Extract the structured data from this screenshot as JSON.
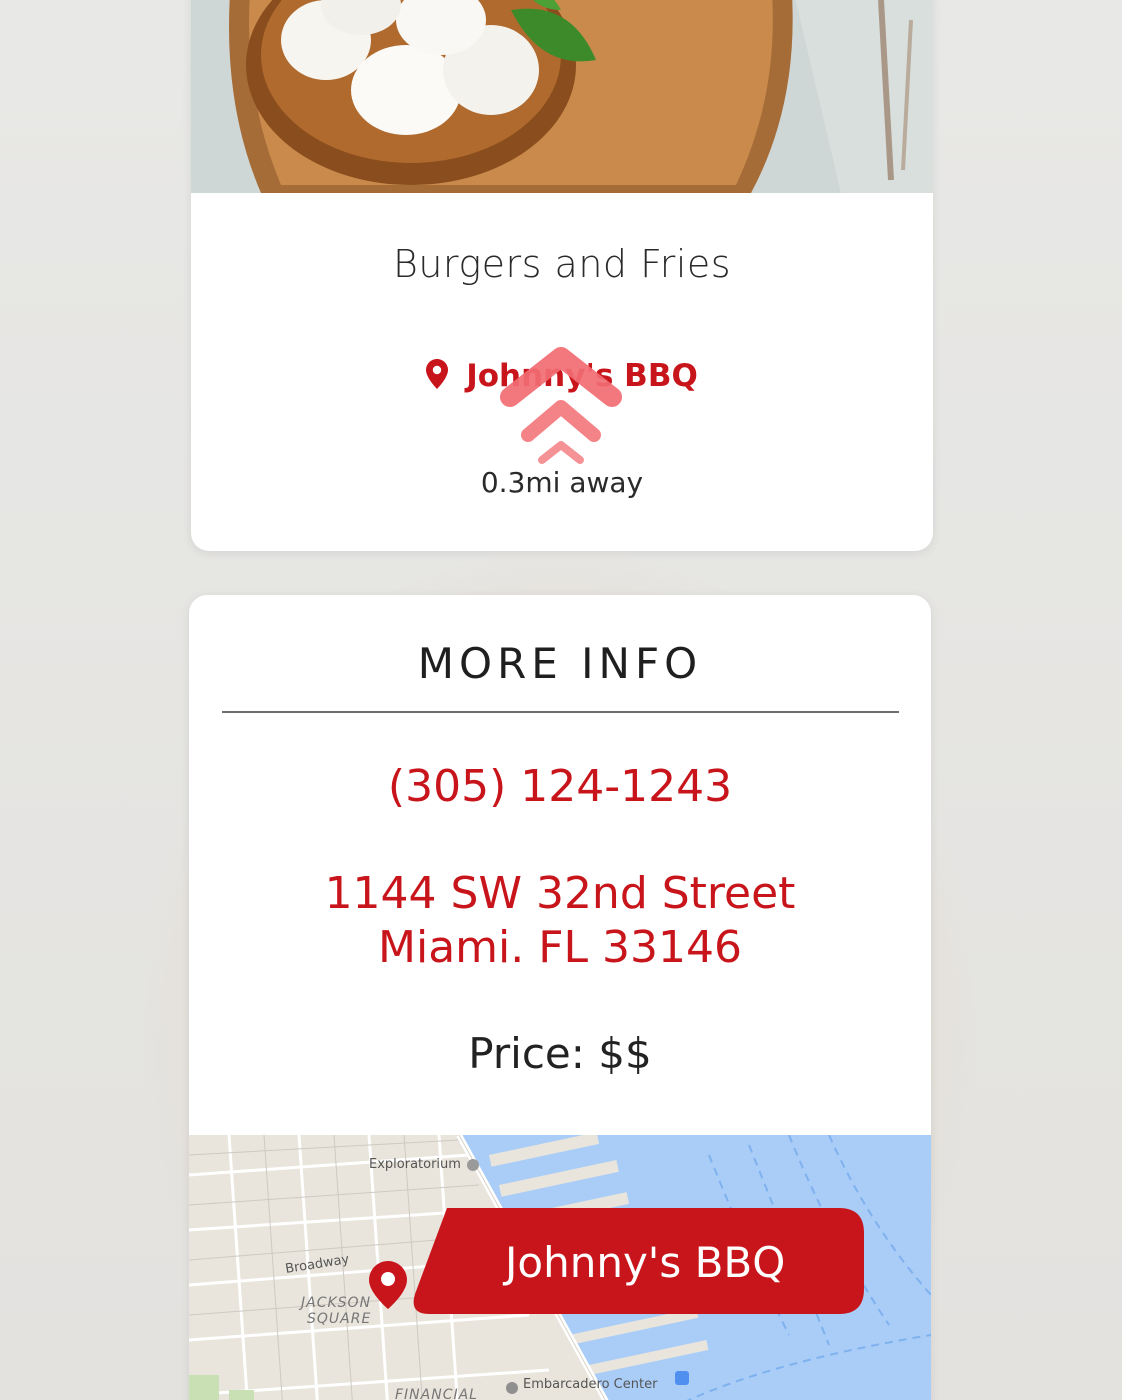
{
  "item": {
    "dish_name": "Burgers and Fries",
    "restaurant_name": "Johnny's BBQ",
    "distance": "0.3mi away"
  },
  "more_info": {
    "title": "MORE INFO",
    "phone": "(305) 124-1243",
    "address_line1": "1144 SW 32nd Street",
    "address_line2": "Miami. FL 33146",
    "price": "Price: $$"
  },
  "map": {
    "callout_label": "Johnny's BBQ",
    "labels": {
      "exploratorium": "Exploratorium",
      "broadway": "Broadway",
      "jackson": "JACKSON",
      "square": "SQUARE",
      "embarcadero": "Embarcadero Center",
      "financial": "FINANCIAL"
    }
  },
  "colors": {
    "accent": "#c8151b",
    "swipe_arrow": "#f26d73",
    "map_water": "#a9cdf7",
    "map_land": "#e9e5dc"
  },
  "icons": {
    "location": "map-pin-icon",
    "swipe": "double-chevron-up-icon"
  }
}
